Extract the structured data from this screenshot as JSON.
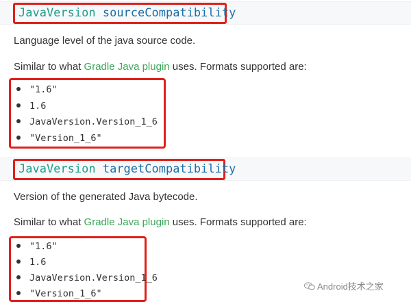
{
  "sections": [
    {
      "signature": {
        "type": "JavaVersion",
        "name": "sourceCompatibility"
      },
      "description": "Language level of the java source code.",
      "similar": {
        "prefix": "Similar to what ",
        "link": "Gradle Java plugin",
        "suffix": " uses. Formats supported are:"
      },
      "formats": [
        "\"1.6\"",
        "1.6",
        "JavaVersion.Version_1_6",
        "\"Version_1_6\""
      ]
    },
    {
      "signature": {
        "type": "JavaVersion",
        "name": "targetCompatibility"
      },
      "description": "Version of the generated Java bytecode.",
      "similar": {
        "prefix": "Similar to what ",
        "link": "Gradle Java plugin",
        "suffix": " uses. Formats supported are:"
      },
      "formats": [
        "\"1.6\"",
        "1.6",
        "JavaVersion.Version_1_6",
        "\"Version_1_6\""
      ]
    }
  ],
  "watermark": {
    "text": "Android技术之家",
    "icon": "wechat-icon"
  },
  "colors": {
    "highlight": "#e0201a",
    "type": "#1d9e8a",
    "name": "#1d6fa5",
    "link": "#3aa757"
  }
}
